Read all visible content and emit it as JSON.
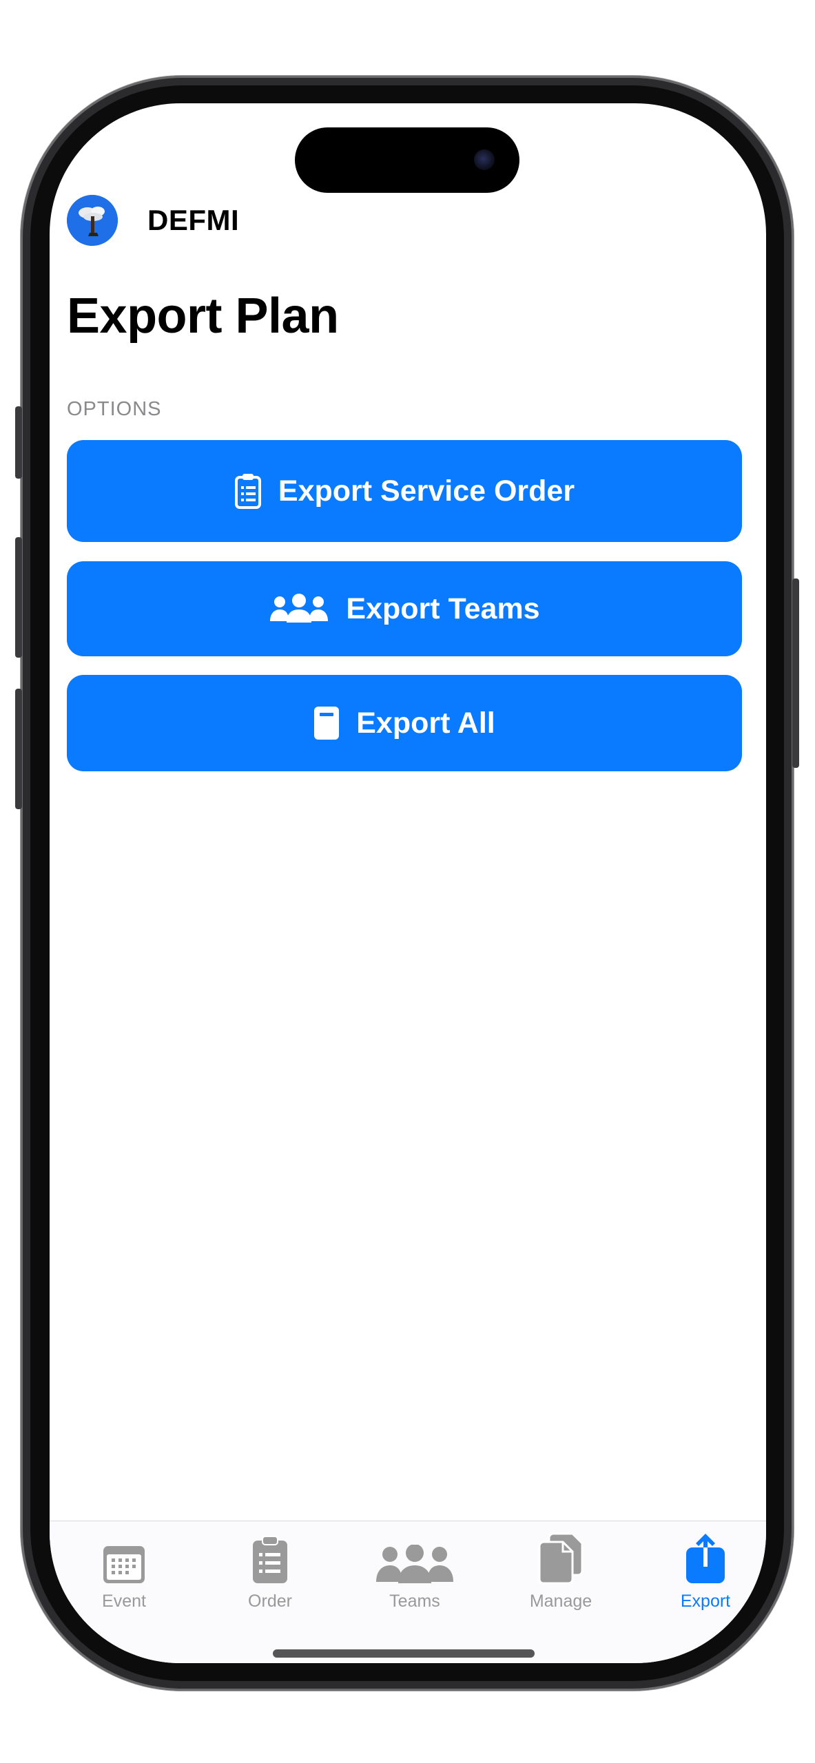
{
  "header": {
    "app_name": "DEFMI",
    "avatar_icon": "tree-logo-icon"
  },
  "page": {
    "title": "Export Plan",
    "section_label": "OPTIONS"
  },
  "buttons": [
    {
      "label": "Export Service Order",
      "icon": "clipboard-list-icon"
    },
    {
      "label": "Export Teams",
      "icon": "people-group-icon"
    },
    {
      "label": "Export All",
      "icon": "document-icon"
    }
  ],
  "tabbar": {
    "items": [
      {
        "label": "Event",
        "icon": "calendar-icon",
        "active": false
      },
      {
        "label": "Order",
        "icon": "clipboard-icon",
        "active": false
      },
      {
        "label": "Teams",
        "icon": "people-icon",
        "active": false
      },
      {
        "label": "Manage",
        "icon": "documents-icon",
        "active": false
      },
      {
        "label": "Export",
        "icon": "share-icon",
        "active": true
      }
    ]
  },
  "colors": {
    "accent": "#0A7AFF",
    "inactive_tab": "#999999",
    "section_label": "#8A8A8E"
  }
}
